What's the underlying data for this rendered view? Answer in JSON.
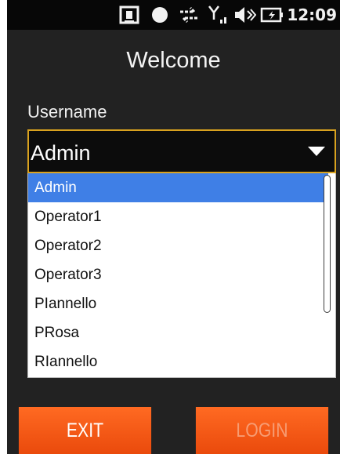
{
  "status_bar": {
    "icons": [
      "connectivity-icon",
      "record-icon",
      "sync-icon",
      "signal-icon",
      "volume-icon",
      "battery-icon"
    ],
    "time": "12:09"
  },
  "header": {
    "title": "Welcome"
  },
  "form": {
    "username_label": "Username",
    "username_value": "Admin",
    "options": [
      "Admin",
      "Operator1",
      "Operator2",
      "Operator3",
      "PIannello",
      "PRosa",
      "RIannello"
    ],
    "selected_index": 0
  },
  "buttons": {
    "exit_label": "EXIT",
    "login_label": "LOGIN"
  },
  "colors": {
    "screen_bg": "#222222",
    "status_bg": "#070707",
    "accent_orange": "#f05a16",
    "combo_border": "#d9a21f",
    "selection_blue": "#3f7fe6",
    "login_disabled_text": "#f79c73"
  }
}
